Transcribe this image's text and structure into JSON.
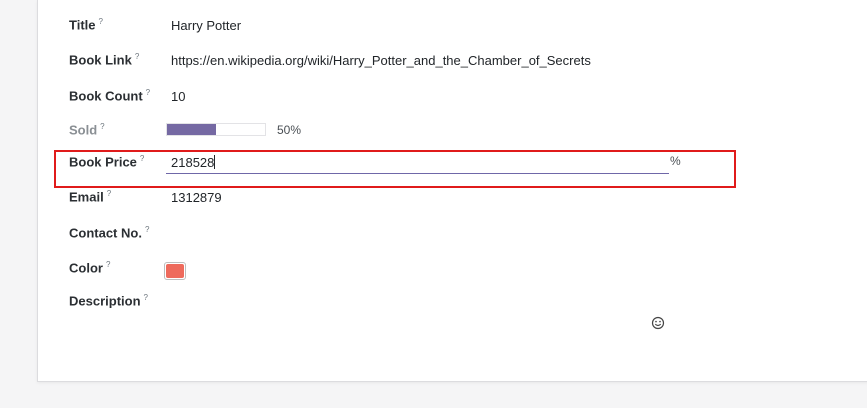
{
  "form": {
    "title": {
      "label": "Title",
      "help": "?",
      "value": "Harry Potter"
    },
    "book_link": {
      "label": "Book Link",
      "help": "?",
      "value": "https://en.wikipedia.org/wiki/Harry_Potter_and_the_Chamber_of_Secrets"
    },
    "book_count": {
      "label": "Book Count",
      "help": "?",
      "value": "10"
    },
    "sold": {
      "label": "Sold",
      "help": "?",
      "percent": 50,
      "text": "50%"
    },
    "book_price": {
      "label": "Book Price",
      "help": "?",
      "value": "218528",
      "suffix": "%"
    },
    "email": {
      "label": "Email",
      "help": "?",
      "value": "1312879"
    },
    "contact": {
      "label": "Contact No.",
      "help": "?",
      "value": ""
    },
    "color": {
      "label": "Color",
      "help": "?",
      "value": "#ee6a5c"
    },
    "description": {
      "label": "Description",
      "help": "?",
      "value": "",
      "emoji_icon": "smiley-icon"
    }
  },
  "colors": {
    "progress": "#7569a3",
    "input_underline": "#6f67a8",
    "highlight_box": "#e01b1b"
  }
}
